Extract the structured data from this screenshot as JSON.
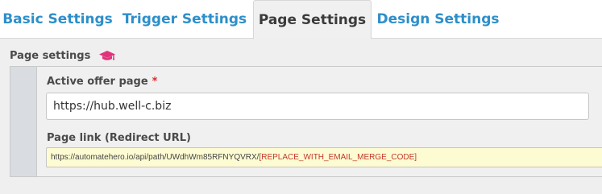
{
  "tabs": [
    {
      "label": "Basic Settings",
      "active": false
    },
    {
      "label": "Trigger Settings",
      "active": false
    },
    {
      "label": "Page Settings",
      "active": true
    },
    {
      "label": "Design Settings",
      "active": false
    }
  ],
  "section": {
    "title": "Page settings",
    "icon": "graduation-cap-icon",
    "icon_color": "#e0337a"
  },
  "fields": {
    "active_offer_page": {
      "label": "Active offer page",
      "required_mark": "*",
      "value": "https://hub.well-c.biz"
    },
    "page_link": {
      "label": "Page link (Redirect URL)",
      "url_base": "https://automatehero.io/api/path/UWdhWm85RFNYQVRX/",
      "url_code": "[REPLACE_WITH_EMAIL_MERGE_CODE]"
    }
  },
  "colors": {
    "tab_link": "#2d8fc9",
    "tab_active_text": "#3b3b3b",
    "required": "#d62b2b",
    "url_highlight_bg": "#fdfbd2",
    "url_code": "#c0392b"
  }
}
